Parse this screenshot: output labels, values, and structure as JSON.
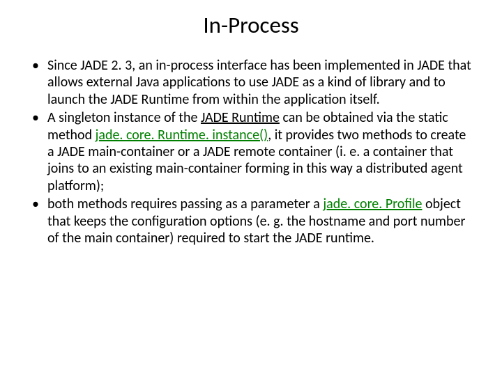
{
  "title": "In-Process",
  "bullets": {
    "b1": "Since JADE 2. 3, an in-process interface has been implemented in JADE that allows external Java applications to use JADE as a kind of library and to launch the JADE Runtime from within the application itself.",
    "b2a": "A singleton instance of the ",
    "b2_runtime": "JADE Runtime",
    "b2b": " can be obtained via the static method ",
    "b2_instance": "jade. core. Runtime. instance()",
    "b2c": ", it provides two methods to create a JADE main-container or a JADE remote container (i. e. a container that joins to an existing main-container forming in this way a distributed agent platform);",
    "b3a": "both methods requires passing as a parameter a ",
    "b3_profile": "jade. core. Profile",
    "b3b": " object that keeps the configuration options (e. g. the hostname and port number of the main container) required to start the JADE runtime."
  }
}
